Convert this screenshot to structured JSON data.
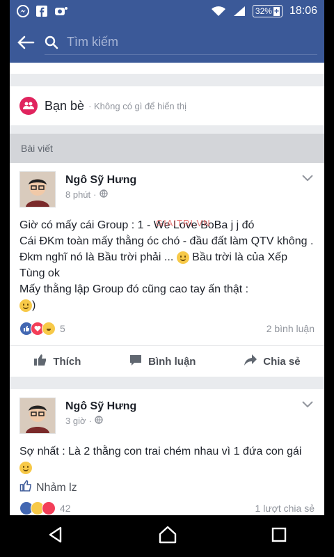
{
  "status": {
    "battery": "32%",
    "time": "18:06"
  },
  "search": {
    "placeholder": "Tìm kiếm"
  },
  "friends": {
    "title": "Bạn bè",
    "note": "Không có gì để hiển thị"
  },
  "posts_section": {
    "title": "Bài viết"
  },
  "posts": [
    {
      "author": "Ngô Sỹ Hưng",
      "time": "8 phút",
      "lines": [
        "Giờ có mấy cái Group : 1 - We Love BoBa j j đó",
        "Cái ĐKm toàn mấy thằng óc chó - đầu đất làm QTV không .",
        "Đkm nghĩ nó là Bầu trời phải ...",
        "Bầu trời là của Xếp Tùng ok",
        "Mấy thằng lập Group đó cũng cao tay ấn thật :"
      ],
      "reactions_count": "5",
      "comments": "2 bình luận",
      "actions": {
        "like": "Thích",
        "comment": "Bình luận",
        "share": "Chia sẻ"
      }
    },
    {
      "author": "Ngô Sỹ Hưng",
      "time": "3 giờ",
      "lines": [
        "Sợ nhất : Là 2 thằng con trai chém nhau vì 1 đứa con gái"
      ],
      "reacted_label": "Nhảm lz",
      "reactions_count": "42",
      "shares": "1 lượt chia sẻ"
    }
  ],
  "watermark": "GIAITRI.VN",
  "colors": {
    "brand": "#3b5998",
    "friends_icon": "#e0245e",
    "like_blue": "#3b5998"
  }
}
